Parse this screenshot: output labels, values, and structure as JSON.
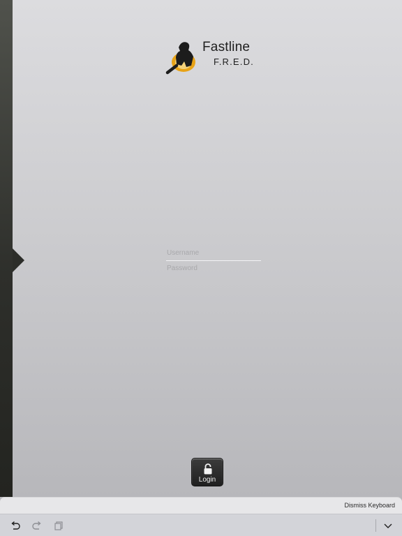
{
  "logo": {
    "title": "Fastline",
    "subtitle": "F.R.E.D.",
    "icon": "worker-magnifier-logo"
  },
  "login": {
    "username_placeholder": "Username",
    "username_value": "",
    "password_placeholder": "Password",
    "password_value": "",
    "button_label": "Login",
    "button_icon": "unlocked-padlock-icon"
  },
  "keyboard": {
    "dismiss_label": "Dismiss Keyboard",
    "undo_icon": "undo-icon",
    "redo_icon": "redo-icon",
    "paste_icon": "clipboard-icon",
    "hide_icon": "chevron-down-icon"
  },
  "colors": {
    "side_panel": "#2e2f2b",
    "logo_accent": "#e8a317",
    "button_bg": "#2a2a2a"
  }
}
